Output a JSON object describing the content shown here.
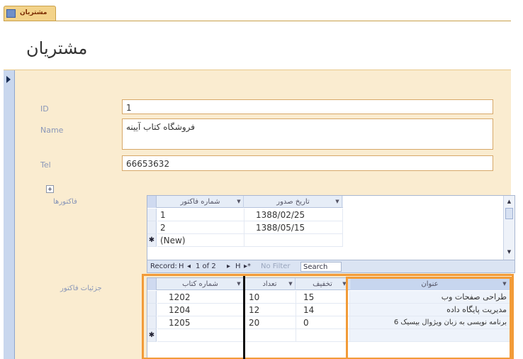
{
  "tab": {
    "label": "مشتریان"
  },
  "header": {
    "title": "مشتریان"
  },
  "form": {
    "id_label": "ID",
    "id_value": "1",
    "name_label": "Name",
    "name_value": "فروشگاه کتاب آیینه",
    "tel_label": "Tel",
    "tel_value": "66653632"
  },
  "invoices": {
    "label": "فاکتورها",
    "col_number": "شماره فاکتور",
    "col_date": "تاریخ صدور",
    "rows": [
      {
        "number": "1",
        "date": "1388/02/25"
      },
      {
        "number": "2",
        "date": "1388/05/15"
      }
    ],
    "new_row": "(New)",
    "nav": {
      "record_label": "Record:",
      "first": "H",
      "prev": "◂",
      "position": "1 of 2",
      "next": "▸",
      "last": "H",
      "new": "▸*",
      "filter": "No Filter",
      "search": "Search"
    }
  },
  "items": {
    "label": "جزئیات فاکتور",
    "col_book": "شماره کتاب",
    "col_qty": "تعداد",
    "col_discount": "تخفیف",
    "col_title": "عنوان",
    "rows": [
      {
        "book": "1202",
        "qty": "10",
        "discount": "15",
        "title": "طراحی صفحات وب"
      },
      {
        "book": "1204",
        "qty": "12",
        "discount": "14",
        "title": "مدیریت پایگاه داده"
      },
      {
        "book": "1205",
        "qty": "20",
        "discount": "0",
        "title": "برنامه نویسی به زبان ویژوال بیسیک 6"
      }
    ]
  },
  "colors": {
    "accent": "#f29b38",
    "form_background": "#faecd0",
    "field_border": "#d7a869"
  },
  "icons": {
    "expand": "plus-box-icon",
    "tab": "form-icon",
    "record_selector": "triangle-right-icon"
  }
}
